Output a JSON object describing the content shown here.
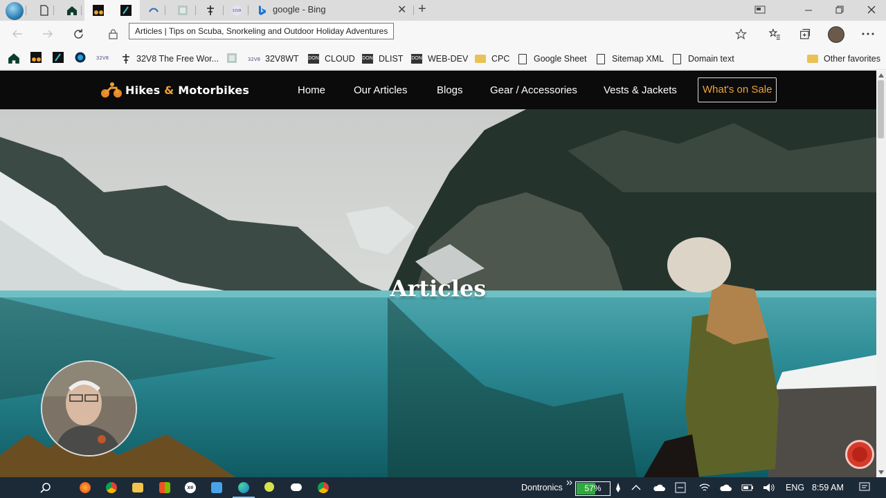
{
  "browser": {
    "active_tab_title": "google - Bing",
    "tooltip": "Articles | Tips on Scuba, Snorkeling and Outdoor Holiday Adventures",
    "tabs": [
      "document-icon",
      "document-icon",
      "home-icon",
      "site-icon",
      "site-icon",
      "wave-icon",
      "image-icon",
      "pin-icon",
      "32v8-icon",
      "bing-icon"
    ],
    "new_tab_label": "+",
    "close_tab_label": "✕"
  },
  "favorites": {
    "items": [
      {
        "label": "32V8 The Free Wor...",
        "icon": "pin-icon"
      },
      {
        "label": "32V8WT",
        "icon": "32v8-icon"
      },
      {
        "label": "CLOUD",
        "icon": "dkn-icon"
      },
      {
        "label": "DLIST",
        "icon": "dkn-icon"
      },
      {
        "label": "WEB-DEV",
        "icon": "dkn-icon"
      },
      {
        "label": "CPC",
        "icon": "folder-icon"
      },
      {
        "label": "Google Sheet",
        "icon": "document-icon"
      },
      {
        "label": "Sitemap XML",
        "icon": "document-icon"
      },
      {
        "label": "Domain text",
        "icon": "document-icon"
      }
    ],
    "other": "Other favorites"
  },
  "site": {
    "logo": {
      "part1": "Hikes",
      "amp": "&",
      "part2": "Motorbikes"
    },
    "nav": [
      "Home",
      "Our Articles",
      "Blogs",
      "Gear / Accessories",
      "Vests & Jackets",
      "What's on Sale"
    ],
    "hero_title": "Articles",
    "accent_color": "#f5a23a"
  },
  "taskbar": {
    "user": "Dontronics",
    "battery_label": "57%",
    "battery_level": 0.57,
    "language": "ENG",
    "clock": "8:59 AM"
  }
}
